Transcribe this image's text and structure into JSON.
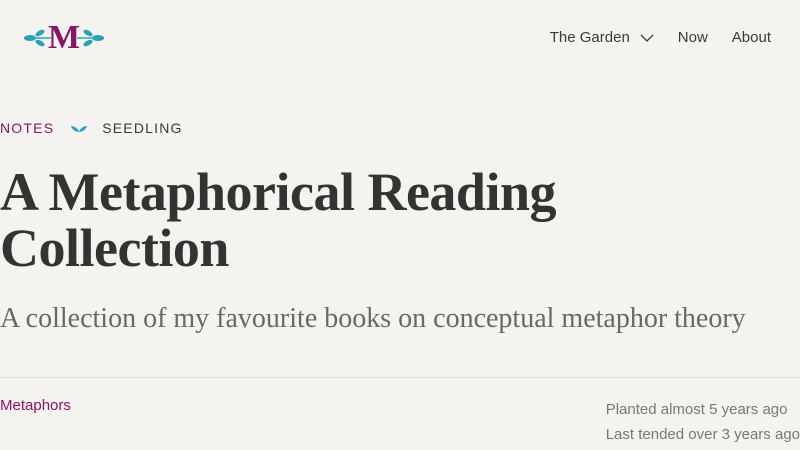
{
  "header": {
    "logo_letter": "M",
    "nav": [
      {
        "label": "The Garden",
        "has_dropdown": true
      },
      {
        "label": "Now"
      },
      {
        "label": "About"
      }
    ]
  },
  "breadcrumb": {
    "section": "NOTES",
    "stage": "SEEDLING"
  },
  "article": {
    "title": "A Metaphorical Reading Collection",
    "subtitle": "A collection of my favourite books on conceptual metaphor theory",
    "tag": "Metaphors",
    "planted": "Planted almost 5 years ago",
    "tended": "Last tended over 3 years ago"
  },
  "colors": {
    "background": "#f5f3ef",
    "accent": "#8a1466",
    "leaf": "#2aa3b8",
    "text": "#3a3a38"
  },
  "icons": {
    "logo_leaves": "leaf-branch-icon",
    "dropdown": "chevron-down-icon",
    "seedling": "seedling-icon"
  }
}
